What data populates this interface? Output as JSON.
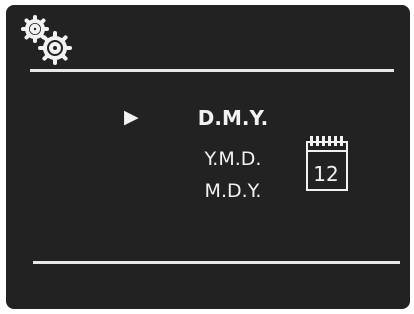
{
  "header": {
    "icon": "settings-gears-icon"
  },
  "date_format": {
    "selected_index": 0,
    "options": [
      {
        "label": "D.M.Y."
      },
      {
        "label": "Y.M.D."
      },
      {
        "label": "M.D.Y."
      }
    ],
    "cursor_icon": "triangle-right-icon"
  },
  "calendar": {
    "icon": "calendar-icon",
    "day": "12"
  }
}
